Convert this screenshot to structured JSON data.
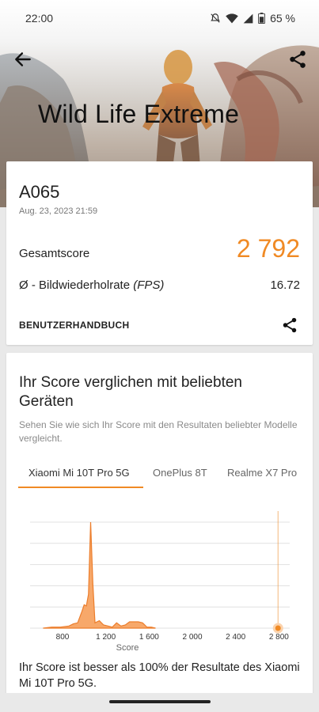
{
  "status_bar": {
    "time": "22:00",
    "battery": "65 %"
  },
  "hero": {
    "title": "Wild Life Extreme"
  },
  "result": {
    "device": "A065",
    "date": "Aug. 23, 2023 21:59",
    "score_label": "Gesamtscore",
    "score_value": "2 792",
    "fps_label_prefix": "Ø - Bildwiederholrate ",
    "fps_label_unit": "(FPS)",
    "fps_value": "16.72",
    "manual_label": "BENUTZERHANDBUCH"
  },
  "compare": {
    "title": "Ihr Score verglichen mit beliebten Geräten",
    "subtitle": "Sehen Sie wie sich Ihr Score mit den Resultaten beliebter Modelle vergleicht.",
    "tabs": [
      "Xiaomi Mi 10T Pro 5G",
      "OnePlus 8T",
      "Realme X7 Pro"
    ],
    "verdict": "Ihr Score ist besser als 100% der Resultate des Xiaomi Mi 10T Pro 5G."
  },
  "chart_data": {
    "type": "area",
    "xlabel": "Score",
    "x_ticks": [
      800,
      1200,
      1600,
      2000,
      2400,
      2800
    ],
    "tick_labels": [
      "800",
      "1 200",
      "1 600",
      "2 000",
      "2 400",
      "2 800"
    ],
    "xlim": [
      500,
      2900
    ],
    "ylim": [
      0,
      100
    ],
    "x": [
      620,
      700,
      780,
      860,
      900,
      940,
      980,
      1000,
      1020,
      1040,
      1060,
      1080,
      1100,
      1140,
      1180,
      1220,
      1260,
      1300,
      1340,
      1380,
      1420,
      1460,
      1500,
      1540,
      1580,
      1620,
      1660
    ],
    "values": [
      0,
      1,
      1,
      2,
      4,
      5,
      16,
      22,
      21,
      32,
      100,
      42,
      5,
      7,
      3,
      2,
      1,
      5,
      2,
      3,
      6,
      6,
      6,
      5,
      1,
      1,
      0
    ],
    "marker_x": 2792,
    "grid": "horizontal",
    "colors": {
      "fill": "#f7a86a",
      "stroke": "#ec7d2b",
      "marker": "#f08a24",
      "grid": "#e0e0e0"
    }
  },
  "colors": {
    "accent": "#f08a24",
    "text": "#222222",
    "muted": "#8a8a8a"
  }
}
